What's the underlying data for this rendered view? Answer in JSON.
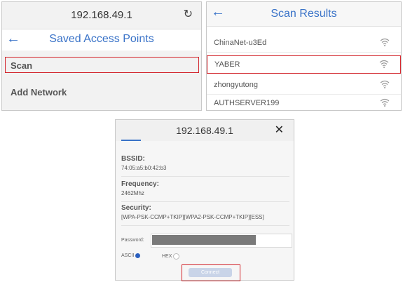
{
  "panel_saved": {
    "url": "192.168.49.1",
    "title": "Saved Access Points",
    "items": [
      "Scan",
      "Add Network"
    ]
  },
  "panel_scan": {
    "title": "Scan Results",
    "networks": [
      "ChinaNet-u3Ed",
      "YABER",
      "zhongyutong",
      "AUTHSERVER199"
    ]
  },
  "panel_connect": {
    "url": "192.168.49.1",
    "fields": [
      {
        "label": "BSSID:",
        "value": "74:05:a5:b0:42:b3"
      },
      {
        "label": "Frequency:",
        "value": "2462Mhz"
      },
      {
        "label": "Security:",
        "value": "[WPA-PSK-CCMP+TKIP][WPA2-PSK-CCMP+TKIP][ESS]"
      }
    ],
    "password_label": "Password:",
    "radio_ascii": "ASCII",
    "radio_hex": "HEX",
    "connect_label": "Connect"
  },
  "colors": {
    "accent": "#3a73c8",
    "highlight": "#d2232a"
  }
}
